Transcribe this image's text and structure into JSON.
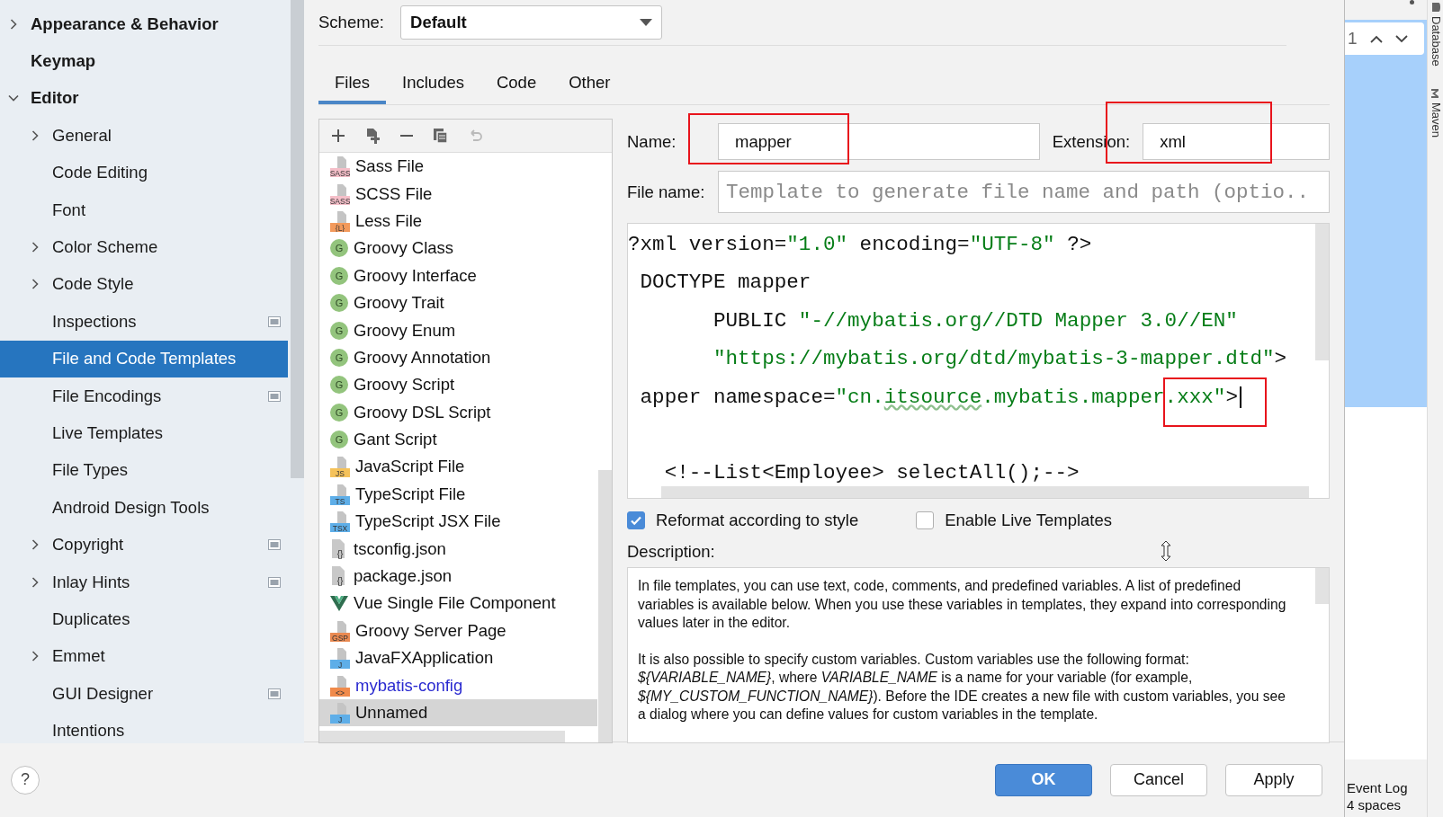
{
  "sidebar": {
    "items": [
      {
        "label": "Appearance & Behavior",
        "expanded": false,
        "selected": false,
        "scoped": false
      },
      {
        "label": "Keymap",
        "selected": false,
        "scoped": false
      },
      {
        "label": "Editor",
        "expanded": true,
        "selected": false,
        "scoped": false,
        "children": [
          {
            "label": "General",
            "expanded": false,
            "selected": false,
            "scoped": false
          },
          {
            "label": "Code Editing",
            "selected": false,
            "scoped": false
          },
          {
            "label": "Font",
            "selected": false,
            "scoped": false
          },
          {
            "label": "Color Scheme",
            "expanded": false,
            "selected": false,
            "scoped": false
          },
          {
            "label": "Code Style",
            "expanded": false,
            "selected": false,
            "scoped": false
          },
          {
            "label": "Inspections",
            "selected": false,
            "scoped": true
          },
          {
            "label": "File and Code Templates",
            "selected": true,
            "scoped": false
          },
          {
            "label": "File Encodings",
            "selected": false,
            "scoped": true
          },
          {
            "label": "Live Templates",
            "selected": false,
            "scoped": false
          },
          {
            "label": "File Types",
            "selected": false,
            "scoped": false
          },
          {
            "label": "Android Design Tools",
            "selected": false,
            "scoped": false
          },
          {
            "label": "Copyright",
            "expanded": false,
            "selected": false,
            "scoped": true
          },
          {
            "label": "Inlay Hints",
            "expanded": false,
            "selected": false,
            "scoped": true
          },
          {
            "label": "Duplicates",
            "selected": false,
            "scoped": false
          },
          {
            "label": "Emmet",
            "expanded": false,
            "selected": false,
            "scoped": false
          },
          {
            "label": "GUI Designer",
            "selected": false,
            "scoped": true
          },
          {
            "label": "Intentions",
            "selected": false,
            "scoped": false
          }
        ]
      }
    ]
  },
  "scheme": {
    "label": "Scheme:",
    "value": "Default"
  },
  "tabs": [
    {
      "label": "Files",
      "selected": true
    },
    {
      "label": "Includes",
      "selected": false
    },
    {
      "label": "Code",
      "selected": false
    },
    {
      "label": "Other",
      "selected": false
    }
  ],
  "templates": {
    "toolbar": [
      {
        "kind": "add",
        "disabled": false
      },
      {
        "kind": "add-file",
        "disabled": false
      },
      {
        "kind": "remove",
        "disabled": false
      },
      {
        "kind": "copy",
        "disabled": false
      },
      {
        "kind": "reset",
        "disabled": true
      }
    ],
    "items": [
      {
        "label": "Sass File",
        "kind": "file",
        "badge": "SASS",
        "color": "#f5bfc9",
        "selected": false,
        "custom": false
      },
      {
        "label": "SCSS File",
        "kind": "file",
        "badge": "SASS",
        "color": "#f5bfc9",
        "selected": false,
        "custom": false
      },
      {
        "label": "Less File",
        "kind": "file",
        "badge": "{L}",
        "color": "#f39a5c",
        "selected": false,
        "custom": false
      },
      {
        "label": "Groovy Class",
        "kind": "circle",
        "badge": "G",
        "color": "#93c47d",
        "selected": false,
        "custom": false
      },
      {
        "label": "Groovy Interface",
        "kind": "circle",
        "badge": "G",
        "color": "#93c47d",
        "selected": false,
        "custom": false
      },
      {
        "label": "Groovy Trait",
        "kind": "circle",
        "badge": "G",
        "color": "#93c47d",
        "selected": false,
        "custom": false
      },
      {
        "label": "Groovy Enum",
        "kind": "circle",
        "badge": "G",
        "color": "#93c47d",
        "selected": false,
        "custom": false
      },
      {
        "label": "Groovy Annotation",
        "kind": "circle",
        "badge": "G",
        "color": "#93c47d",
        "selected": false,
        "custom": false
      },
      {
        "label": "Groovy Script",
        "kind": "circle",
        "badge": "G",
        "color": "#93c47d",
        "selected": false,
        "custom": false
      },
      {
        "label": "Groovy DSL Script",
        "kind": "circle",
        "badge": "G",
        "color": "#93c47d",
        "selected": false,
        "custom": false
      },
      {
        "label": "Gant Script",
        "kind": "circle",
        "badge": "G",
        "color": "#93c47d",
        "selected": false,
        "custom": false
      },
      {
        "label": "JavaScript File",
        "kind": "file",
        "badge": "JS",
        "color": "#f5c25a",
        "selected": false,
        "custom": false
      },
      {
        "label": "TypeScript File",
        "kind": "file",
        "badge": "TS",
        "color": "#5eaee8",
        "selected": false,
        "custom": false
      },
      {
        "label": "TypeScript JSX File",
        "kind": "file",
        "badge": "TSX",
        "color": "#5eaee8",
        "selected": false,
        "custom": false
      },
      {
        "label": "tsconfig.json",
        "kind": "json",
        "badge": "{}",
        "color": "#c8c8c8",
        "selected": false,
        "custom": false
      },
      {
        "label": "package.json",
        "kind": "json",
        "badge": "{}",
        "color": "#c8c8c8",
        "selected": false,
        "custom": false
      },
      {
        "label": "Vue Single File Component",
        "kind": "vue",
        "color": "#2f6e4f",
        "selected": false,
        "custom": false
      },
      {
        "label": "Groovy Server Page",
        "kind": "file",
        "badge": "GSP",
        "color": "#ea8a52",
        "selected": false,
        "custom": false
      },
      {
        "label": "JavaFXApplication",
        "kind": "file",
        "badge": "J",
        "color": "#5eaee8",
        "selected": false,
        "custom": false
      },
      {
        "label": "mybatis-config",
        "kind": "file",
        "badge": "<>",
        "color": "#f08a4b",
        "selected": false,
        "custom": true
      },
      {
        "label": "Unnamed",
        "kind": "file",
        "badge": "J",
        "color": "#5eaee8",
        "selected": true,
        "custom": false
      }
    ]
  },
  "form": {
    "name": {
      "label": "Name:",
      "value": "mapper",
      "highlighted": true
    },
    "extension": {
      "label": "Extension:",
      "value": "xml",
      "highlighted": true
    },
    "file_name": {
      "label": "File name:",
      "placeholder": "Template to generate file name and path (optio.."
    }
  },
  "editor": {
    "lines": [
      {
        "cursor": false,
        "tokens": [
          {
            "text": "?xml version=",
            "kind": "plain"
          },
          {
            "text": "\"1.0\"",
            "kind": "string"
          },
          {
            "text": " encoding=",
            "kind": "plain"
          },
          {
            "text": "\"UTF-8\"",
            "kind": "string"
          },
          {
            "text": " ?>",
            "kind": "plain"
          }
        ]
      },
      {
        "cursor": false,
        "tokens": [
          {
            "text": " DOCTYPE mapper",
            "kind": "plain"
          }
        ]
      },
      {
        "cursor": false,
        "tokens": [
          {
            "text": "       PUBLIC ",
            "kind": "plain"
          },
          {
            "text": "\"-//mybatis.org//DTD Mapper 3.0//EN\"",
            "kind": "string"
          }
        ]
      },
      {
        "cursor": false,
        "tokens": [
          {
            "text": "       \"https://mybatis.org/dtd/mybatis-3-mapper.dtd\"",
            "kind": "string"
          },
          {
            "text": ">",
            "kind": "plain"
          }
        ]
      },
      {
        "cursor": true,
        "tokens": [
          {
            "text": " apper namespace=",
            "kind": "plain"
          },
          {
            "text": "\"cn.",
            "kind": "string"
          },
          {
            "text": "itsource",
            "kind": "string",
            "typo": true
          },
          {
            "text": ".mybatis.mapper",
            "kind": "string"
          },
          {
            "text": ".xxx\"",
            "kind": "string",
            "highlighted": true
          },
          {
            "text": ">",
            "kind": "plain",
            "highlighted": true
          }
        ]
      },
      {
        "cursor": false
      },
      {
        "cursor": false,
        "tokens": [
          {
            "text": "   <!--List<Employee> selectAll();-->",
            "kind": "plain"
          }
        ]
      }
    ]
  },
  "options": [
    {
      "label": "Reformat according to style",
      "checked": true
    },
    {
      "label": "Enable Live Templates",
      "checked": false
    }
  ],
  "description": {
    "label": "Description:",
    "paragraphs": [
      "In file templates, you can use text, code, comments, and predefined variables. A list of predefined variables is available below. When you use these variables in templates, they expand into corresponding values later in the editor.",
      "It is also possible to specify custom variables. Custom variables use the following format: *${VARIABLE_NAME}*, where *VARIABLE_NAME* is a name for your variable (for example, *${MY_CUSTOM_FUNCTION_NAME}*). Before the IDE creates a new file with custom variables, you see a dialog where you can define values for custom variables in the template."
    ]
  },
  "footer": {
    "help": "?",
    "buttons": [
      {
        "label": "OK",
        "kind": "primary"
      },
      {
        "label": "Cancel",
        "kind": "default"
      },
      {
        "label": "Apply",
        "kind": "default"
      }
    ]
  },
  "ide": {
    "search_count": "1",
    "tool_windows": [
      {
        "label": "Database",
        "kind": "database"
      },
      {
        "label": "Maven",
        "kind": "maven"
      }
    ],
    "status": [
      {
        "text": "Event Log"
      },
      {
        "text": "4 spaces"
      }
    ]
  }
}
